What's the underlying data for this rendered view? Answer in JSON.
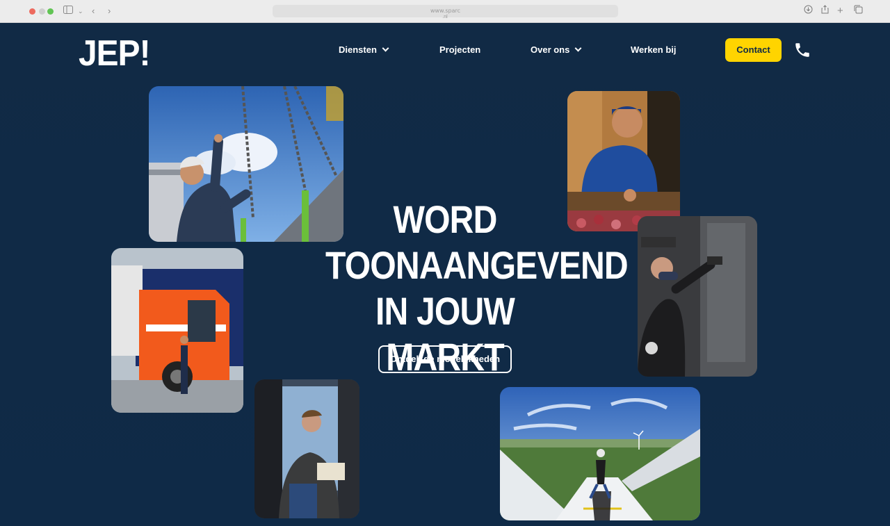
{
  "browser": {
    "url": "www.sparc",
    "url_sub": ".nl"
  },
  "site": {
    "logo": "JEP!",
    "nav": {
      "diensten": "Diensten",
      "projecten": "Projecten",
      "over_ons": "Over ons",
      "werken_bij": "Werken bij",
      "contact": "Contact"
    },
    "hero": {
      "line1": "WORD",
      "line2": "TOONAANGEVEND",
      "line3": "IN JOUW MARKT",
      "cta": "Ontdek de mogelijkheden"
    },
    "colors": {
      "background": "#0f2a45",
      "accent": "#ffd400"
    },
    "icons": [
      "sidebar-icon",
      "back-icon",
      "forward-icon",
      "download-icon",
      "share-icon",
      "new-tab-icon",
      "tabs-icon",
      "phone-icon"
    ]
  }
}
